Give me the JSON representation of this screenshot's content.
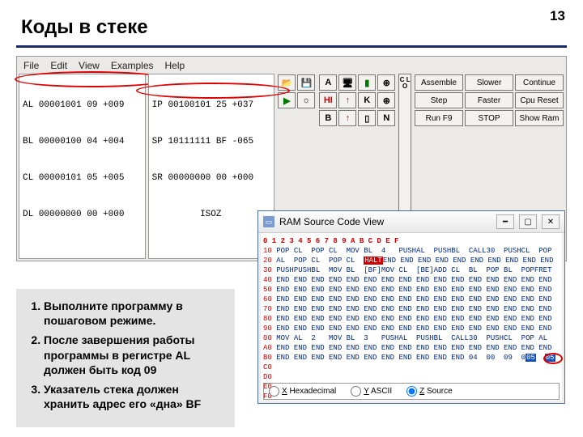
{
  "page_number": "13",
  "title": "Коды в стеке",
  "menubar": [
    "File",
    "Edit",
    "View",
    "Examples",
    "Help"
  ],
  "registers_left": [
    "AL 00001001 09 +009",
    "BL 00000100 04 +004",
    "CL 00000101 05 +005",
    "DL 00000000 00 +000"
  ],
  "registers_right": [
    "IP 00100101 25 +037",
    "SP 10111111 BF -065",
    "SR 00000000 00 +000",
    "         ISOZ"
  ],
  "toolbar_icons_a": [
    "📂",
    "💾",
    "▶",
    "☼"
  ],
  "toolbar_icons_b": [
    "A",
    "HI",
    "B",
    "🖥",
    "↑",
    "↑",
    "▮",
    "⊛",
    "K",
    "▯",
    "⊛",
    "N"
  ],
  "clo_label": "C\nL\nO",
  "buttons": [
    "Assemble",
    "Slower",
    "Continue",
    "Step",
    "Faster",
    "Cpu Reset",
    "Run F9",
    "STOP",
    "Show Ram"
  ],
  "instructions": [
    "Выполните программу в пошаговом режиме.",
    "После завершения работы программы в регистре AL должен быть код 09",
    "Указатель стека должен хранить адрес его «дна» BF"
  ],
  "ram": {
    "title": "RAM Source Code View",
    "cols": "    0   1   2   3   4   5   6   7   8   9   A   B   C   D   E   F",
    "rows": {
      "00": "MOV AL  2   MOV BL  3   PUSHAL  PUSHBL  CALL30  PUSHCL  POP AL",
      "10": "POP CL  POP CL  MOV BL  4   PUSHAL  PUSHBL  CALL30  PUSHCL  POP",
      "20": "AL  POP CL  POP CL  |HALT|END END END END END END END END END END",
      "30": "PUSHPUSHBL  MOV BL  [BF]MOV CL  [BE]ADD CL  BL  POP BL  POPFRET",
      "40": "END END END END END END END END END END END END END END END END",
      "50": "END END END END END END END END END END END END END END END END",
      "60": "END END END END END END END END END END END END END END END END",
      "70": "END END END END END END END END END END END END END END END END",
      "80": "END END END END END END END END END END END END END END END END",
      "90": "END END END END END END END END END END END END END END END END",
      "A0": "END END END END END END END END END END END END END END END END",
      "B0": "END END END END END END END END END END END 04  00  09  0|SEL|  |SEL|",
      "C0": "",
      "D0": "",
      "E0": "",
      "F0": ""
    },
    "radios": {
      "hex": "Hexadecimal",
      "ascii": "ASCII",
      "source": "Source",
      "hex_key": "X",
      "ascii_key": "Y",
      "source_key": "Z"
    }
  }
}
